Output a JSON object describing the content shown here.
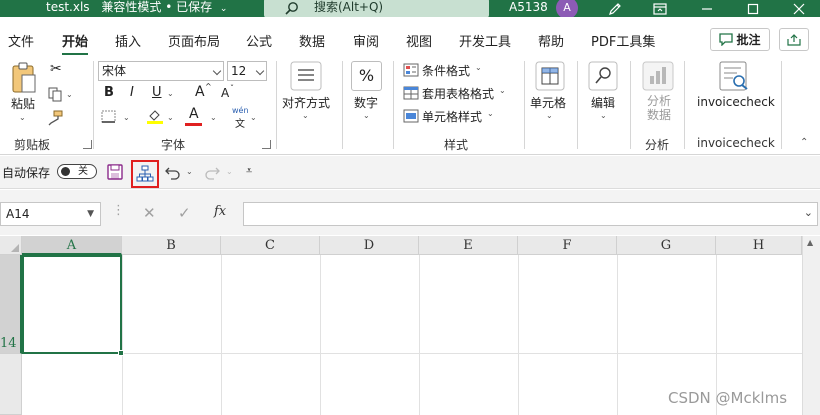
{
  "titlebar": {
    "filename": "test.xls",
    "mode": "兼容性模式 • 已保存",
    "caret": "⌄",
    "search_placeholder": "搜索(Alt+Q)",
    "user_id": "A5138",
    "avatar_letter": "A",
    "bg_color": "#217346"
  },
  "tabs": [
    "文件",
    "开始",
    "插入",
    "页面布局",
    "公式",
    "数据",
    "审阅",
    "视图",
    "开发工具",
    "帮助",
    "PDF工具集"
  ],
  "active_tab": "开始",
  "comment_label": "批注",
  "ribbon": {
    "clipboard": {
      "paste": "粘贴",
      "group": "剪贴板"
    },
    "font": {
      "name": "宋体",
      "size": "12",
      "bold": "B",
      "italic": "I",
      "underline": "U",
      "grow": "A",
      "shrink": "A",
      "font_color_glyph": "A",
      "phonetic_top": "wén",
      "phonetic_bottom": "文",
      "group": "字体"
    },
    "alignment": {
      "label": "对齐方式"
    },
    "number": {
      "label": "数字",
      "symbol": "%"
    },
    "styles": {
      "conditional": "条件格式",
      "table": "套用表格格式",
      "cell": "单元格样式",
      "group": "样式"
    },
    "cells": {
      "label": "单元格"
    },
    "editing": {
      "label": "编辑"
    },
    "analysis": {
      "analyze_data": "分析数据",
      "group": "分析"
    },
    "invoice": {
      "label": "invoicecheck",
      "group": "invoicecheck"
    }
  },
  "qat": {
    "autosave_label": "自动保存",
    "autosave_state": "关"
  },
  "formula_bar": {
    "name_box": "A14",
    "value": "",
    "fx": "fx"
  },
  "grid": {
    "columns": [
      "A",
      "B",
      "C",
      "D",
      "E",
      "F",
      "G",
      "H"
    ],
    "selected_column": "A",
    "rows": [
      "14"
    ],
    "selected_row": "14",
    "selected_cell": "A14"
  },
  "watermark": "CSDN @Mcklms"
}
